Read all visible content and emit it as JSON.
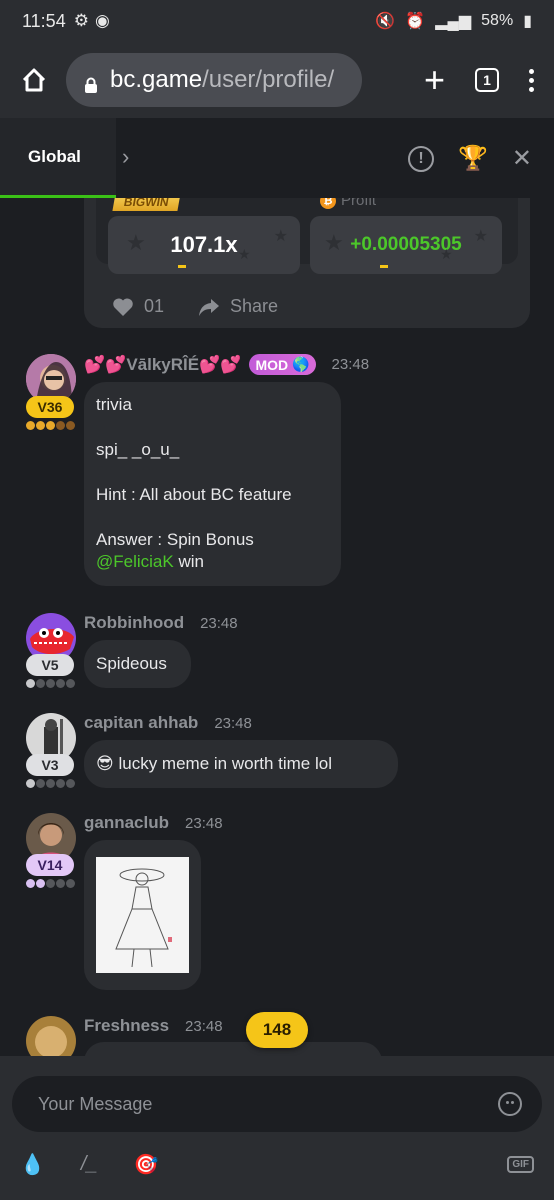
{
  "status_bar": {
    "time": "11:54",
    "battery": "58%"
  },
  "browser": {
    "url_host": "bc.game",
    "url_path": "/user/profile/",
    "tab_count": "1"
  },
  "chat_header": {
    "tab_label": "Global"
  },
  "shared_bet": {
    "bigwin_label": "BIGWIN",
    "profit_label": "Profit",
    "multiplier": "107.1x",
    "profit": "+0.00005305",
    "likes": "01",
    "share_label": "Share"
  },
  "messages": [
    {
      "username": "💕💕VālkyRÎÉ💕💕",
      "badge": "MOD",
      "time": "23:48",
      "vip": "V36",
      "lines": [
        "trivia",
        "spi_ _o_u_",
        "Hint : All about BC feature",
        "Answer : Spin Bonus"
      ],
      "mention": "@FeliciaK",
      "mention_suffix": " win"
    },
    {
      "username": "Robbinhood",
      "time": "23:48",
      "vip": "V5",
      "text": "Spideous"
    },
    {
      "username": "capitan ahhab",
      "time": "23:48",
      "vip": "V3",
      "emoji": "😎",
      "text": "lucky meme in worth time lol"
    },
    {
      "username": "gannaclub",
      "time": "23:48",
      "vip": "V14"
    },
    {
      "username": "Freshness",
      "time": "23:48"
    }
  ],
  "new_messages_count": "148",
  "composer": {
    "placeholder": "Your Message"
  },
  "colors": {
    "accent_green": "#3bc117",
    "gold": "#f5c518",
    "mod_purple": "#c25bd8"
  }
}
